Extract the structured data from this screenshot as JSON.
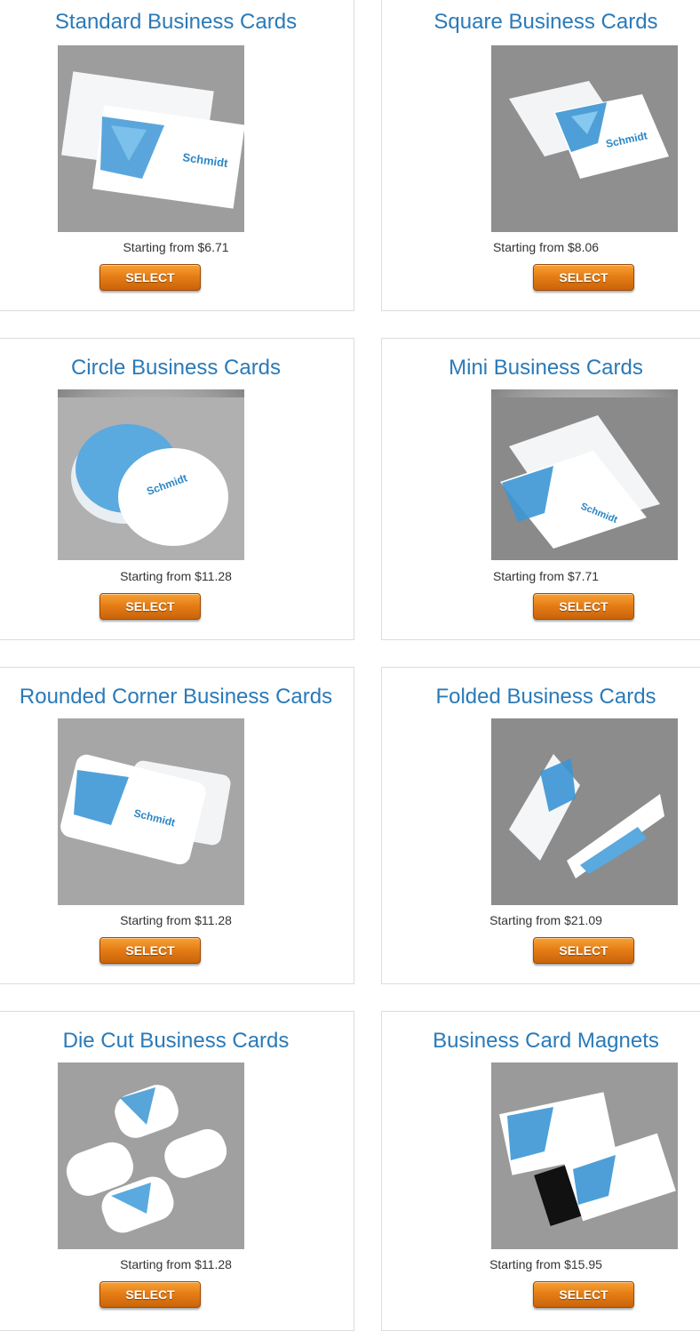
{
  "products": [
    {
      "title": "Standard Business Cards",
      "price": "Starting from $6.71",
      "button": "SELECT",
      "image": "standard-business-card-photo",
      "bg": "#a9a9a9"
    },
    {
      "title": "Square Business Cards",
      "price": "Starting from $8.06",
      "button": "SELECT",
      "image": "square-business-card-photo",
      "bg": "#9a9a9a"
    },
    {
      "title": "Circle Business Cards",
      "price": "Starting from $11.28",
      "button": "SELECT",
      "image": "circle-business-card-photo",
      "bg": "#b4b4b4"
    },
    {
      "title": "Mini Business Cards",
      "price": "Starting from $7.71",
      "button": "SELECT",
      "image": "mini-business-card-photo",
      "bg": "#8d8d8d"
    },
    {
      "title": "Rounded Corner Business Cards",
      "price": "Starting from $11.28",
      "button": "SELECT",
      "image": "rounded-corner-business-card-photo",
      "bg": "#aaaaaa"
    },
    {
      "title": "Folded Business Cards",
      "price": "Starting from $21.09",
      "button": "SELECT",
      "image": "folded-business-card-photo",
      "bg": "#8f8f8f"
    },
    {
      "title": "Die Cut Business Cards",
      "price": "Starting from $11.28",
      "button": "SELECT",
      "image": "die-cut-business-card-photo",
      "bg": "#a5a5a5"
    },
    {
      "title": "Business Card Magnets",
      "price": "Starting from $15.95",
      "button": "SELECT",
      "image": "business-card-magnet-photo",
      "bg": "#9e9e9e"
    }
  ],
  "colors": {
    "title": "#2a7ab8",
    "accent": "#e67e16",
    "card_blue": "#2e8fd0"
  }
}
